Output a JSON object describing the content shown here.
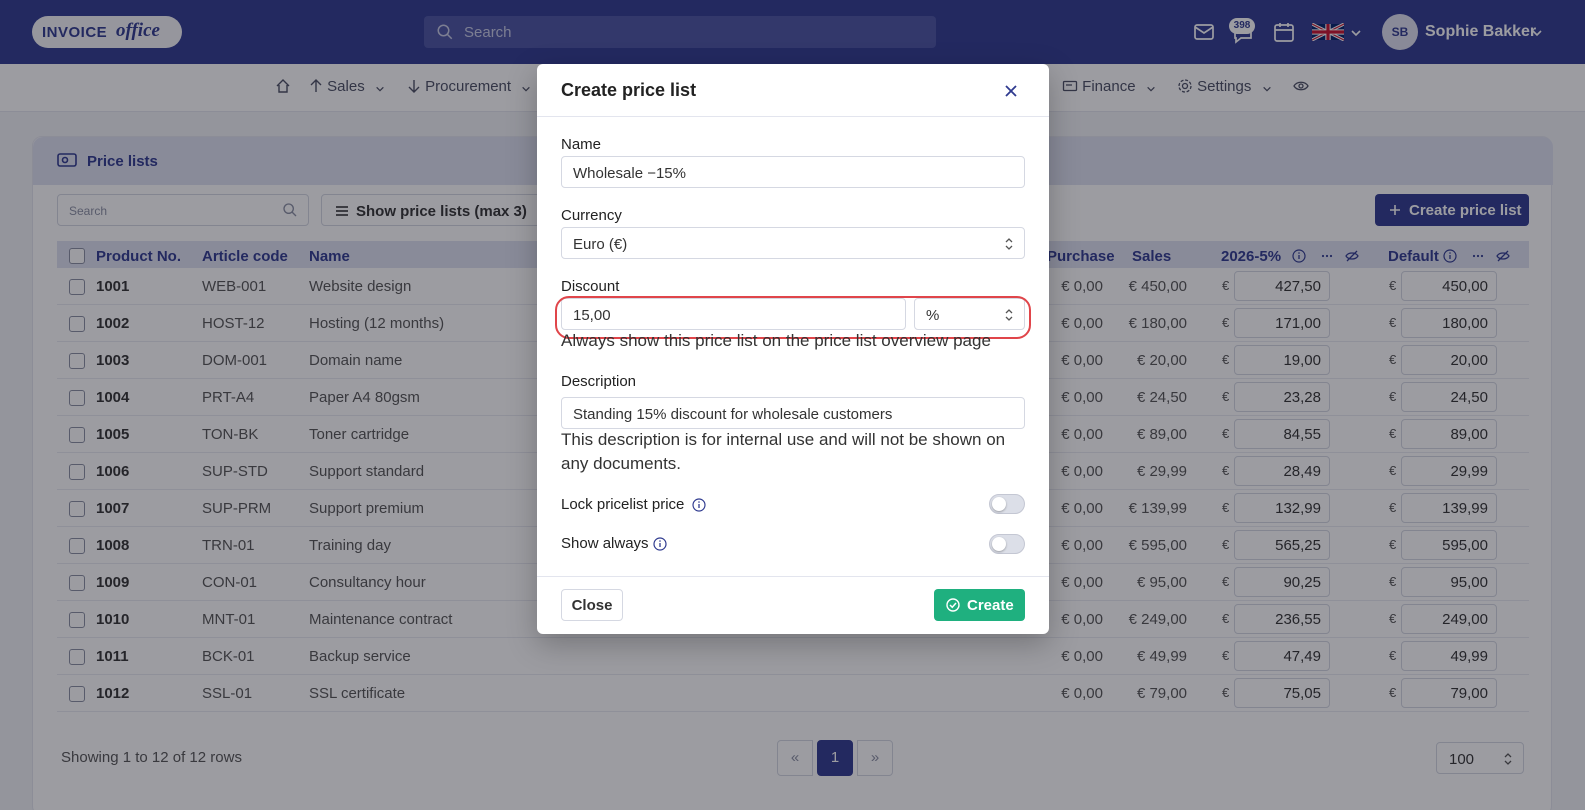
{
  "app": {
    "logo_text_1": "INVOICE",
    "logo_text_2": "office",
    "search_placeholder": "Search",
    "notifications_count": "398",
    "user_initials": "SB",
    "user_name": "Sophie Bakker"
  },
  "nav": {
    "sales": "Sales",
    "procurement": "Procurement",
    "finance": "Finance",
    "settings": "Settings"
  },
  "card": {
    "title": "Price lists",
    "search_placeholder": "Search",
    "show_button": "Show price lists (max 3)",
    "create_button": "Create price list"
  },
  "table": {
    "headers": {
      "product_no": "Product No.",
      "article_code": "Article code",
      "name": "Name",
      "purchase": "Purchase",
      "sales": "Sales",
      "pricelist_1": "2026-5%",
      "pricelist_2": "Default"
    },
    "rows": [
      {
        "no": "1001",
        "code": "WEB-001",
        "name": "Website design",
        "purchase": "€ 0,00",
        "sales": "€ 450,00",
        "pl1": "427,50",
        "pl2": "450,00"
      },
      {
        "no": "1002",
        "code": "HOST-12",
        "name": "Hosting (12 months)",
        "purchase": "€ 0,00",
        "sales": "€ 180,00",
        "pl1": "171,00",
        "pl2": "180,00"
      },
      {
        "no": "1003",
        "code": "DOM-001",
        "name": "Domain name",
        "purchase": "€ 0,00",
        "sales": "€ 20,00",
        "pl1": "19,00",
        "pl2": "20,00"
      },
      {
        "no": "1004",
        "code": "PRT-A4",
        "name": "Paper A4 80gsm",
        "purchase": "€ 0,00",
        "sales": "€ 24,50",
        "pl1": "23,28",
        "pl2": "24,50"
      },
      {
        "no": "1005",
        "code": "TON-BK",
        "name": "Toner cartridge",
        "purchase": "€ 0,00",
        "sales": "€ 89,00",
        "pl1": "84,55",
        "pl2": "89,00"
      },
      {
        "no": "1006",
        "code": "SUP-STD",
        "name": "Support standard",
        "purchase": "€ 0,00",
        "sales": "€ 29,99",
        "pl1": "28,49",
        "pl2": "29,99"
      },
      {
        "no": "1007",
        "code": "SUP-PRM",
        "name": "Support premium",
        "purchase": "€ 0,00",
        "sales": "€ 139,99",
        "pl1": "132,99",
        "pl2": "139,99"
      },
      {
        "no": "1008",
        "code": "TRN-01",
        "name": "Training day",
        "purchase": "€ 0,00",
        "sales": "€ 595,00",
        "pl1": "565,25",
        "pl2": "595,00"
      },
      {
        "no": "1009",
        "code": "CON-01",
        "name": "Consultancy hour",
        "purchase": "€ 0,00",
        "sales": "€ 95,00",
        "pl1": "90,25",
        "pl2": "95,00"
      },
      {
        "no": "1010",
        "code": "MNT-01",
        "name": "Maintenance contract",
        "purchase": "€ 0,00",
        "sales": "€ 249,00",
        "pl1": "236,55",
        "pl2": "249,00"
      },
      {
        "no": "1011",
        "code": "BCK-01",
        "name": "Backup service",
        "purchase": "€ 0,00",
        "sales": "€ 49,99",
        "pl1": "47,49",
        "pl2": "49,99"
      },
      {
        "no": "1012",
        "code": "SSL-01",
        "name": "SSL certificate",
        "purchase": "€ 0,00",
        "sales": "€ 79,00",
        "pl1": "75,05",
        "pl2": "79,00"
      }
    ],
    "currency_symbol": "€",
    "footer_info": "Showing 1 to 12 of 12 rows",
    "pager_prev": "«",
    "pager_current": "1",
    "pager_next": "»",
    "page_size": "100"
  },
  "modal": {
    "title": "Create price list",
    "name_label": "Name",
    "name_value": "Wholesale −15%",
    "currency_label": "Currency",
    "currency_value": "Euro (€)",
    "discount_label": "Discount",
    "discount_value": "15,00",
    "discount_unit": "%",
    "discount_help": "Always show this price list on the price list overview page",
    "description_label": "Description",
    "description_value": "Standing 15% discount for wholesale customers",
    "description_help": "This description is for internal use and will not be shown on any documents.",
    "lock_label": "Lock pricelist price",
    "show_always_label": "Show always",
    "close_button": "Close",
    "create_button": "Create"
  },
  "colors": {
    "brand": "#2f3a8f",
    "create_green": "#1fb07f",
    "highlight_ring": "#e0454a"
  }
}
